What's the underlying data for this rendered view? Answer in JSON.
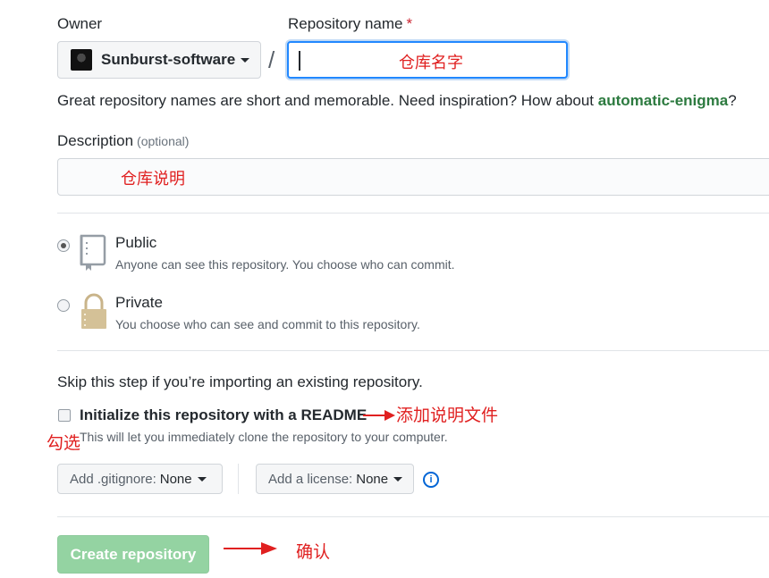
{
  "owner": {
    "label": "Owner",
    "selected": "Sunburst-software"
  },
  "repo_name": {
    "label": "Repository name",
    "required_marker": "*",
    "value": "仓库名字"
  },
  "separator": "/",
  "hint": {
    "text": "Great repository names are short and memorable. Need inspiration? How about ",
    "suggestion": "automatic-enigma",
    "suffix": "?"
  },
  "description": {
    "label": "Description",
    "optional": "(optional)",
    "value": "仓库说明"
  },
  "visibility": {
    "public": {
      "title": "Public",
      "subtitle": "Anyone can see this repository. You choose who can commit.",
      "selected": true
    },
    "private": {
      "title": "Private",
      "subtitle": "You choose who can see and commit to this repository.",
      "selected": false
    }
  },
  "import_note": "Skip this step if you’re importing an existing repository.",
  "readme": {
    "label": "Initialize this repository with a README",
    "subtitle": "This will let you immediately clone the repository to your computer.",
    "checked": false
  },
  "gitignore": {
    "prefix": "Add .gitignore:",
    "value": "None"
  },
  "license": {
    "prefix": "Add a license:",
    "value": "None"
  },
  "info_icon_text": "i",
  "create_button": "Create repository",
  "annotations": {
    "readme": "添加说明文件",
    "check": "勾选",
    "confirm": "确认"
  },
  "colors": {
    "annotation": "#e02020",
    "create_button_bg": "#94d3a2",
    "focus_border": "#2188ff",
    "suggestion": "#2c7a3f"
  }
}
